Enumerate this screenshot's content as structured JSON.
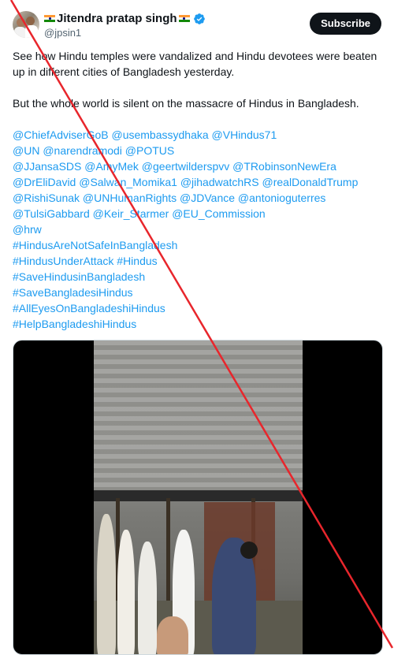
{
  "author": {
    "display_name": "Jitendra pratap singh",
    "handle": "@jpsin1",
    "flag_icon": "india-flag-icon",
    "verified_icon": "verified-badge-icon",
    "verified_color": "#1d9bf0"
  },
  "header": {
    "subscribe_label": "Subscribe"
  },
  "tweet": {
    "paragraph_1": "See how Hindu temples were vandalized and Hindu devotees were beaten up in different cities of Bangladesh yesterday.",
    "paragraph_2": "But the whole world is silent on the massacre of Hindus in Bangladesh.",
    "tag_lines": [
      "@ChiefAdviserGoB @usembassydhaka @VHindus71",
      "@UN @narendramodi @POTUS",
      "@JJansaSDS @AmyMek @geertwilderspvv @TRobinsonNewEra",
      "@DrEliDavid @Salwan_Momika1 @jihadwatchRS  @realDonaldTrump",
      "@RishiSunak @UNHumanRights @JDVance @antonioguterres",
      "@TulsiGabbard @Keir_Starmer @EU_Commission",
      "@hrw",
      "#HindusAreNotSafeInBangladesh",
      "#HindusUnderAttack #Hindus",
      "#SaveHindusinBangladesh",
      "#SaveBangladesiHindus",
      "#AllEyesOnBangladeshiHindus",
      "#HelpBangladeshiHindus"
    ]
  },
  "colors": {
    "link": "#1d9bf0",
    "text": "#0f1419",
    "muted": "#536471",
    "overlay_slash": "#e8262c"
  }
}
